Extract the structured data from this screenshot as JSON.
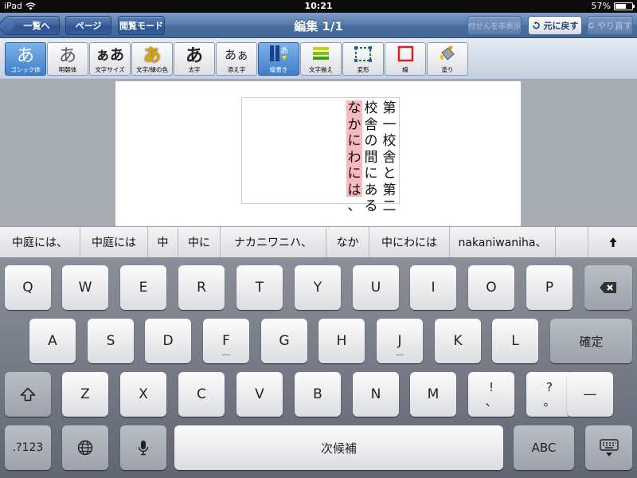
{
  "status": {
    "device": "iPad",
    "time": "10:21",
    "battery": "57%"
  },
  "nav": {
    "back_label": "一覧へ",
    "page_label": "ページ",
    "view_mode_label": "閲覧モード",
    "title": "編集 1/1",
    "hide_sticky_label": "付せんを非表示",
    "undo_label": "元に戻す",
    "redo_label": "やり直す"
  },
  "toolbar": {
    "tools": [
      {
        "glyph": "あ",
        "label": "ゴシック体",
        "active": true
      },
      {
        "glyph": "あ",
        "label": "明朝体"
      },
      {
        "glyph": "ぁあ",
        "label": "文字サイズ"
      },
      {
        "glyph": "あ",
        "label": "文字/縁の色"
      },
      {
        "glyph": "あ",
        "label": "太字"
      },
      {
        "glyph": "あぁ",
        "label": "添え字"
      },
      {
        "glyph": "",
        "label": "縦書き",
        "active": true
      },
      {
        "glyph": "",
        "label": "文字揃え"
      },
      {
        "glyph": "",
        "label": "変形"
      },
      {
        "glyph": "",
        "label": "線"
      },
      {
        "glyph": "",
        "label": "塗り"
      }
    ]
  },
  "document": {
    "columns": [
      {
        "text": "第一校舎と第二",
        "marked": false
      },
      {
        "text": "校舎の間にある",
        "marked": false
      },
      {
        "text": "なかにわには、",
        "marked": true
      }
    ]
  },
  "candidates": {
    "items": [
      "中庭には、",
      "中庭には",
      "中",
      "中に",
      "ナカニワニハ、",
      "なか",
      "中にわには",
      "nakaniwaniha、"
    ]
  },
  "keyboard": {
    "row1": [
      "Q",
      "W",
      "E",
      "R",
      "T",
      "Y",
      "U",
      "I",
      "O",
      "P"
    ],
    "row2": [
      "A",
      "S",
      "D",
      "F",
      "G",
      "H",
      "J",
      "K",
      "L"
    ],
    "confirm": "確定",
    "row3": [
      "Z",
      "X",
      "C",
      "V",
      "B",
      "N",
      "M"
    ],
    "punct1": [
      "!",
      "、"
    ],
    "punct2": [
      "?",
      "。"
    ],
    "dash": "—",
    "numbers": ".?123",
    "space": "次候補",
    "abc": "ABC"
  }
}
